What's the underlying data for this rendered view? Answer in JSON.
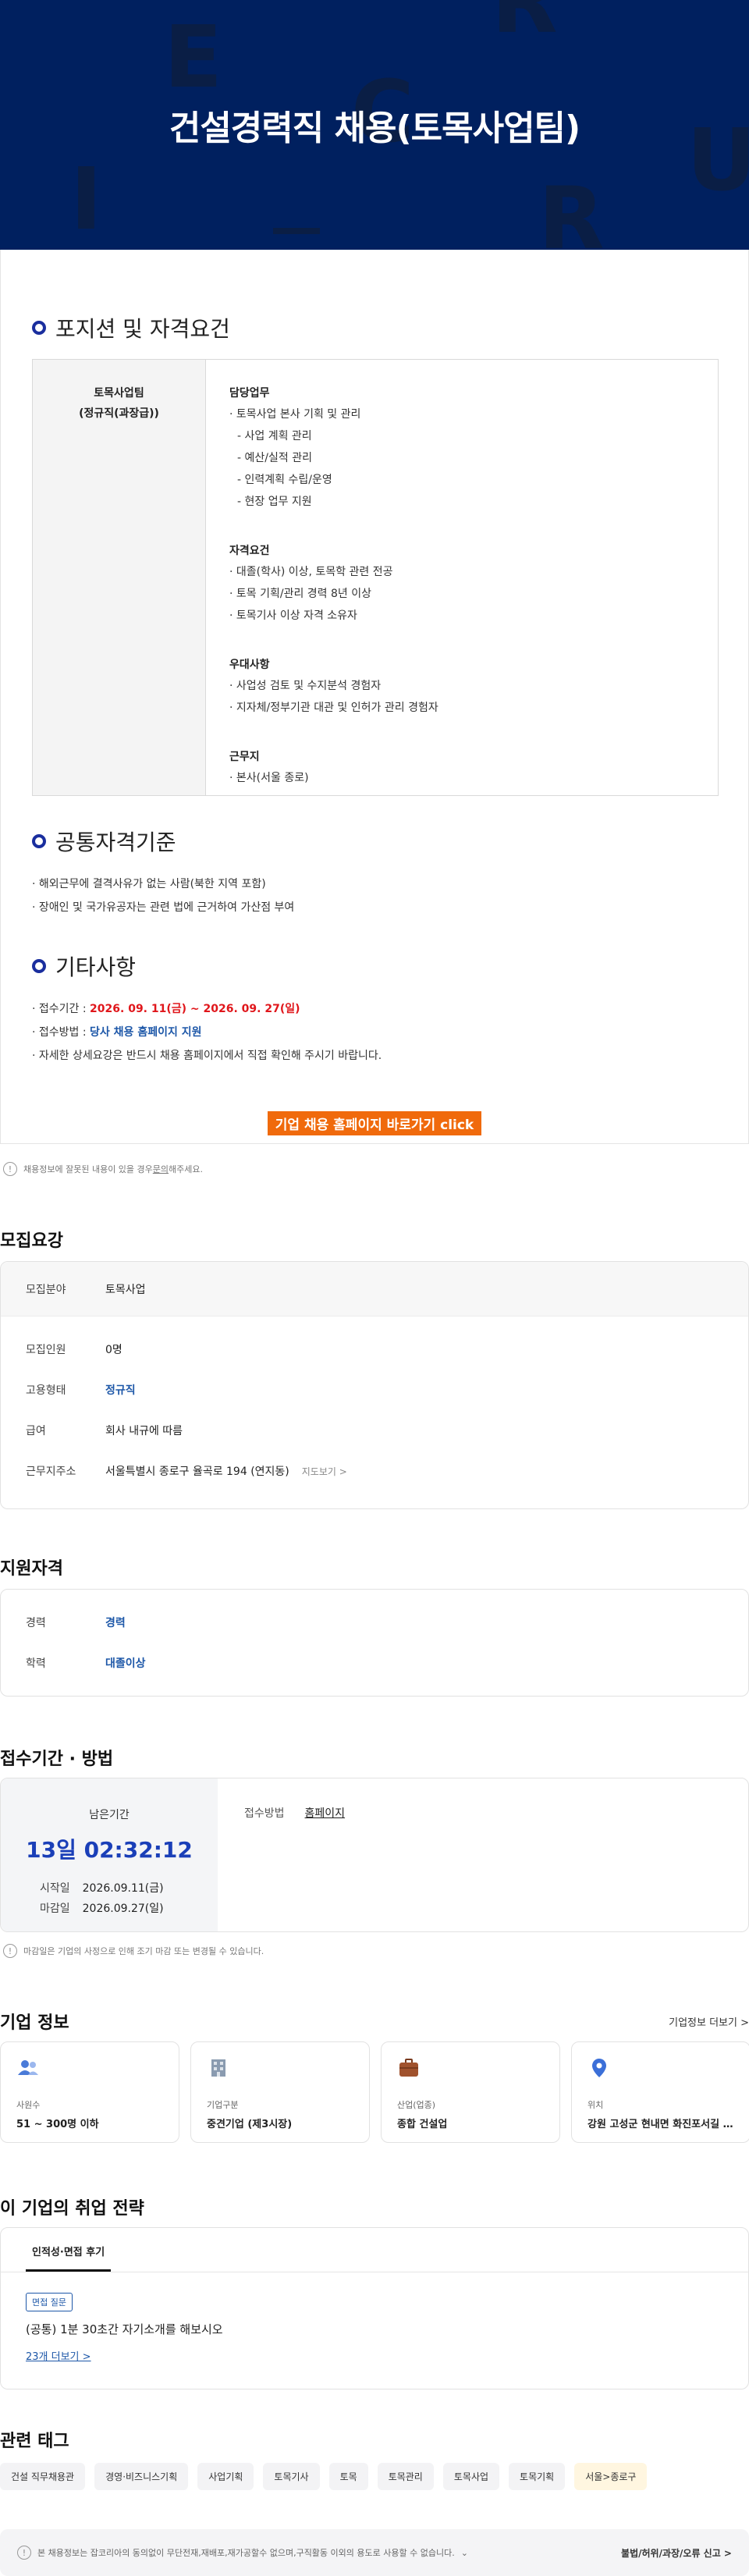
{
  "hero": {
    "title": "건설경력직 채용(토목사업팀)",
    "bg_letters": [
      "E",
      "C",
      "R",
      "U",
      "I",
      "R"
    ]
  },
  "position": {
    "heading": "포지션 및 자격요건",
    "team": "토목사업팀",
    "rank": "(정규직(과장급))",
    "groups": [
      {
        "title": "담당업무",
        "lines": [
          "· 토목사업 본사 기획 및 관리",
          "- 사업 계획 관리",
          "- 예산/실적 관리",
          "- 인력계획 수립/운영",
          "- 현장 업무 지원"
        ]
      },
      {
        "title": "자격요건",
        "lines": [
          "· 대졸(학사) 이상, 토목학 관련 전공",
          "· 토목 기획/관리 경력 8년 이상",
          "· 토목기사 이상 자격 소유자"
        ]
      },
      {
        "title": "우대사항",
        "lines": [
          "· 사업성 검토 및 수지분석 경험자",
          "· 지자체/정부기관 대관 및 인허가 관리 경험자"
        ]
      },
      {
        "title": "근무지",
        "lines": [
          "· 본사(서울 종로)"
        ]
      }
    ]
  },
  "common": {
    "heading": "공통자격기준",
    "lines": [
      "· 해외근무에 결격사유가 없는 사람(북한 지역 포함)",
      "· 장애인 및 국가유공자는 관련 법에 근거하여 가산점 부여"
    ]
  },
  "etc": {
    "heading": "기타사항",
    "period_label": "· 접수기간 : ",
    "period_value": "2026. 09. 11(금) ~ 2026. 09. 27(일)",
    "method_label": "· 접수방법 : ",
    "method_value": "당사 채용 홈페이지 지원",
    "detail": "· 자세한 상세요강은 반드시 채용 홈페이지에서 직접 확인해 주시기 바랍니다.",
    "cta": "기업 채용 홈페이지 바로가기 click"
  },
  "notice1": {
    "icon": "info-icon",
    "text_pre": "채용정보에 잘못된 내용이 있을 경우 ",
    "link": "문의",
    "text_post": "해주세요."
  },
  "recruit": {
    "title": "모집요강",
    "field_label": "모집분야",
    "field_value": "토목사업",
    "rows": [
      {
        "k": "모집인원",
        "v": "0명",
        "blue": false
      },
      {
        "k": "고용형태",
        "v": "정규직",
        "blue": true
      },
      {
        "k": "급여",
        "v": "회사 내규에 따름",
        "blue": false
      },
      {
        "k": "근무지주소",
        "v": "서울특별시 종로구 율곡로 194 (연지동)",
        "blue": false
      }
    ],
    "map_link": "지도보기 >"
  },
  "qual": {
    "title": "지원자격",
    "rows": [
      {
        "k": "경력",
        "v": "경력"
      },
      {
        "k": "학력",
        "v": "대졸이상"
      }
    ]
  },
  "apply": {
    "title": "접수기간 · 방법",
    "remain_label": "남은기간",
    "remain": "13일 02:32:12",
    "start_label": "시작일",
    "start": "2026.09.11(금)",
    "end_label": "마감일",
    "end": "2026.09.27(일)",
    "method_label": "접수방법",
    "method": "홈페이지"
  },
  "notice2": {
    "icon": "info-icon",
    "text": "마감일은 기업의 사정으로 인해 조기 마감 또는 변경될 수 있습니다."
  },
  "company": {
    "title": "기업 정보",
    "more": "기업정보 더보기 >",
    "cards": [
      {
        "icon": "people-icon",
        "label": "사원수",
        "value": "51 ~ 300명 이하",
        "color": "#4a7bd8"
      },
      {
        "icon": "building-icon",
        "label": "기업구분",
        "value": "중견기업 (제3시장)",
        "color": "#8a9bb0"
      },
      {
        "icon": "briefcase-icon",
        "label": "산업(업종)",
        "value": "종합 건설업",
        "color": "#a0522d"
      },
      {
        "icon": "location-pin-icon",
        "label": "위치",
        "value": "강원 고성군 현내면 화진포서길 1...",
        "color": "#3b6fd8"
      }
    ]
  },
  "strategy": {
    "title": "이 기업의 취업 전략",
    "tab": "인적성·면접 후기",
    "badge": "면접 질문",
    "question": "(공통) 1분 30초간 자기소개를 해보시오",
    "more": "23개 더보기 >"
  },
  "tags": {
    "title": "관련 태그",
    "items": [
      "건설 직무채용관",
      "경영·비즈니스기획",
      "사업기획",
      "토목기사",
      "토목",
      "토목관리",
      "토목사업",
      "토목기획",
      "서울>종로구"
    ]
  },
  "footer": {
    "notice": "본 채용정보는 잡코리아의 동의없이 무단전재,재배포,재가공할수 없으며,구직활동 이외의 용도로 사용할 수 없습니다.",
    "report": "불법/허위/과장/오류 신고 >"
  }
}
